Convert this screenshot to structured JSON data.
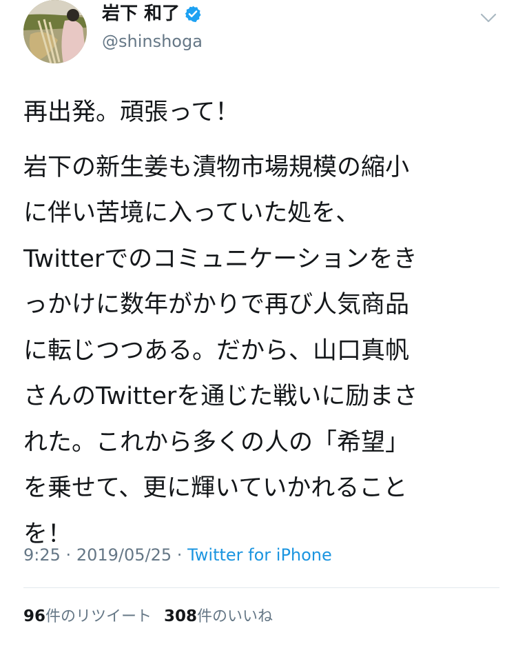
{
  "user": {
    "display_name": "岩下 和了",
    "handle": "@shinshoga",
    "verified": true
  },
  "tweet": {
    "paragraphs": [
      "再出発。頑張って！",
      "岩下の新生姜も漬物市場規模の縮小\nに伴い苦境に入っていた処を、\nTwitterでのコミュニケーションをき\nっかけに数年がかりで再び人気商品\nに転じつつある。だから、山口真帆\nさんのTwitterを通じた戦いに励まさ\nれた。これから多くの人の「希望」\nを乗せて、更に輝いていかれること\nを！"
    ],
    "time": "9:25",
    "date": "2019/05/25",
    "separator": "·",
    "source": "Twitter for iPhone"
  },
  "stats": {
    "retweets_count": "96",
    "retweets_label": "件のリツイート",
    "likes_count": "308",
    "likes_label": "件のいいね"
  },
  "icons": {
    "verified": "verified-badge-icon",
    "caret": "chevron-down-icon"
  },
  "colors": {
    "text": "#14171a",
    "muted": "#657786",
    "link": "#1b95e0",
    "verified": "#1da1f2",
    "divider": "#e1e8ed"
  }
}
